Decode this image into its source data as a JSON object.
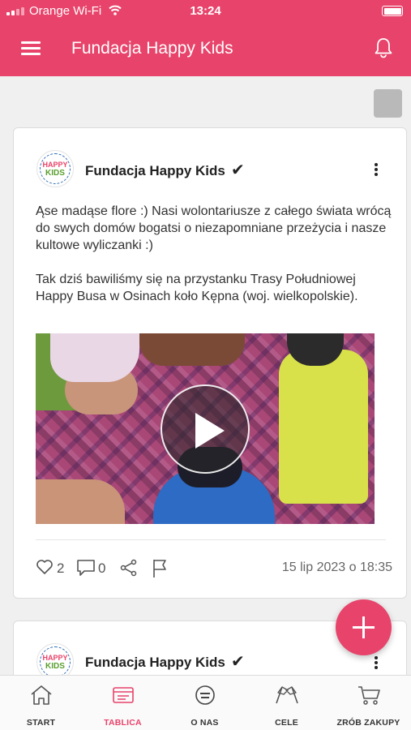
{
  "status_bar": {
    "carrier": "Orange Wi-Fi",
    "time": "13:24"
  },
  "app_bar": {
    "title": "Fundacja Happy Kids",
    "menu_icon": "hamburger-icon",
    "notification_icon": "bell-icon"
  },
  "posts": [
    {
      "author": "Fundacja Happy Kids",
      "verified_mark": "✔",
      "logo": {
        "line1": "HAPPY",
        "line2": "KIDS"
      },
      "text": [
        "Ąse madąse flore :) Nasi wolontariusze z całego świata wrócą do swych domów bogatsi o niezapomniane przeżycia i nasze kultowe wyliczanki :)",
        "Tak dziś bawiliśmy się na przystanku Trasy Południowej Happy Busa w Osinach koło Kępna (woj. wielkopolskie)."
      ],
      "likes": "2",
      "comments": "0",
      "date": "15 lip 2023 o 18:35"
    },
    {
      "author": "Fundacja Happy Kids",
      "verified_mark": "✔",
      "logo": {
        "line1": "HAPPY",
        "line2": "KIDS"
      }
    }
  ],
  "fab": {
    "icon": "plus-icon"
  },
  "bottom_nav": {
    "active": "TABLICA",
    "items": [
      {
        "label": "START",
        "icon": "home-icon"
      },
      {
        "label": "TABLICA",
        "icon": "board-icon"
      },
      {
        "label": "O NAS",
        "icon": "happy-kids-icon"
      },
      {
        "label": "CELE",
        "icon": "flags-icon"
      },
      {
        "label": "ZRÓB ZAKUPY",
        "icon": "cart-icon"
      }
    ]
  },
  "colors": {
    "brand": "#e8436a",
    "background": "#f0f0f0"
  }
}
